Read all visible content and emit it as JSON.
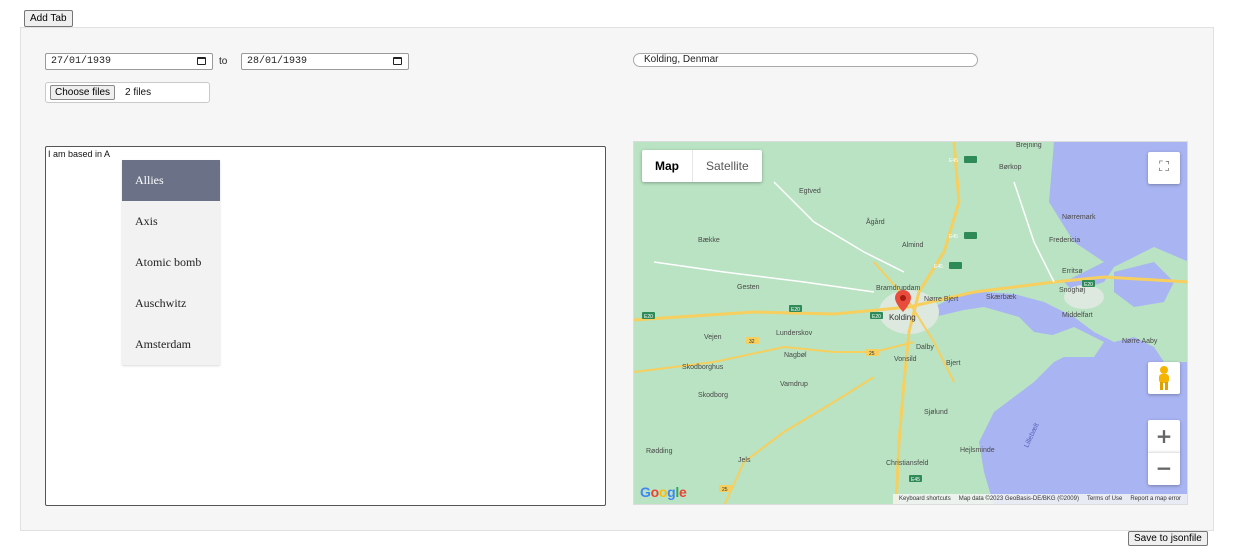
{
  "toolbar": {
    "add_tab_label": "Add Tab",
    "save_label": "Save to jsonfile"
  },
  "form": {
    "date_from": "27/01/1939",
    "date_to": "28/01/1939",
    "to_label": "to",
    "choose_files_label": "Choose files",
    "files_count": "2 files",
    "location_value": "Kolding, Denmar",
    "text_value": "I am based in A"
  },
  "suggestions": {
    "items": [
      "Allies",
      "Axis",
      "Atomic bomb",
      "Auschwitz",
      "Amsterdam"
    ],
    "selected": "Allies",
    "highlight_color": "#6b7186"
  },
  "map": {
    "type_map": "Map",
    "type_satellite": "Satellite",
    "labels": [
      "Børkop",
      "Egtved",
      "Ågård",
      "Almind",
      "Nørremark",
      "Fredericia",
      "Bække",
      "Gesten",
      "Erritsø",
      "Snoghøj",
      "Bramdrupdam",
      "Nørre Bjert",
      "Skærbæk",
      "Kolding",
      "Middelfart",
      "Vejen",
      "Lunderskov",
      "Nørre Aaby",
      "Nagbøl",
      "Dalby",
      "Vonsild",
      "Bjert",
      "Skodborghus",
      "Vamdrup",
      "Skodborg",
      "Sjølund",
      "Rødding",
      "Jels",
      "Christiansfeld",
      "Hejlsminde",
      "Lillebælt",
      "Brejning"
    ],
    "roads": [
      "E45",
      "E45",
      "E45",
      "E20",
      "E20",
      "E20",
      "E20",
      "32",
      "25",
      "25",
      "E45"
    ],
    "attribution": {
      "shortcuts": "Keyboard shortcuts",
      "data": "Map data ©2023 GeoBasis-DE/BKG (©2009)",
      "terms": "Terms of Use",
      "report": "Report a map error"
    },
    "google_logo": "Google",
    "colors": {
      "land": "#b9e3c2",
      "water": "#a9b4f2",
      "road": "#f6cf5e"
    }
  }
}
